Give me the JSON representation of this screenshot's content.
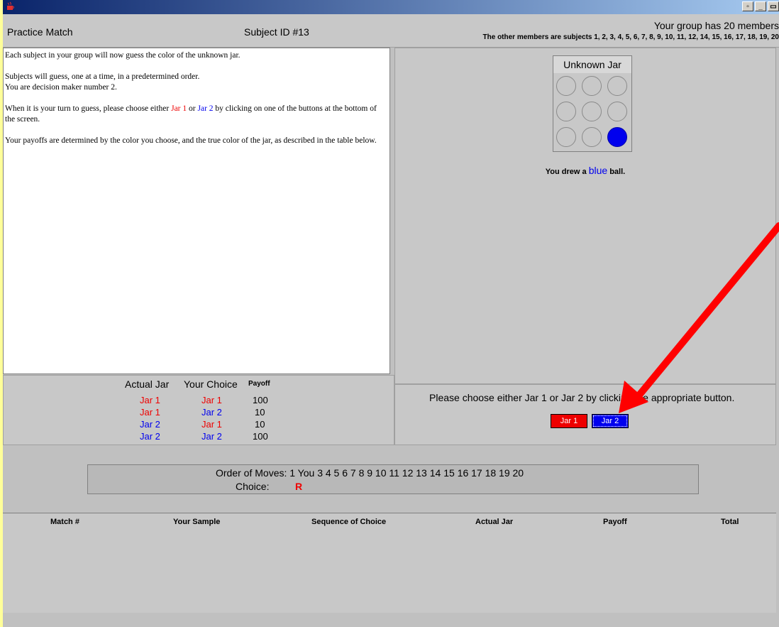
{
  "window": {
    "title_icon": "java-cup-icon",
    "controls": [
      "-□",
      "_",
      "▭"
    ]
  },
  "header": {
    "left": "Practice Match",
    "middle": "Subject ID #13",
    "right_title": "Your group has 20 members",
    "right_sub": "The other members are subjects 1, 2, 3, 4, 5, 6, 7, 8, 9, 10, 11, 12, 14, 15, 16, 17, 18, 19, 20"
  },
  "instructions": {
    "p1": "Each subject in your group will now guess the color of the unknown jar.",
    "p2a": "Subjects will guess, one at a time, in a predetermined order.",
    "p2b": "You are decision maker number 2.",
    "p3_pre": "When it is your turn to guess, please choose either ",
    "p3_jar1": "Jar 1",
    "p3_or": " or ",
    "p3_jar2": "Jar 2",
    "p3_post": " by clicking on one of the buttons at the bottom of the screen.",
    "p4": "Your payoffs are determined by the color you choose, and the true color of the jar, as described in the table below."
  },
  "jar": {
    "title": "Unknown Jar",
    "drew_prefix": "You drew a ",
    "drew_color": "blue",
    "drew_suffix": " ball."
  },
  "choose": {
    "prompt": "Please choose either Jar 1 or Jar 2 by clicking the appropriate button.",
    "jar1_label": "Jar 1",
    "jar2_label": "Jar 2"
  },
  "payoff_table": {
    "headers": [
      "Actual Jar",
      "Your Choice",
      "Payoff"
    ],
    "rows": [
      [
        "Jar 1",
        "Jar 1",
        "100"
      ],
      [
        "Jar 1",
        "Jar 2",
        "10"
      ],
      [
        "Jar 2",
        "Jar 1",
        "10"
      ],
      [
        "Jar 2",
        "Jar 2",
        "100"
      ]
    ]
  },
  "order": {
    "label": "Order of Moves:  1  You  3  4  5  6  7  8  9  10  11  12  13  14  15  16  17  18  19  20",
    "choice_label": "Choice:",
    "choice_value": "R"
  },
  "history": {
    "headers": [
      "Match #",
      "Your Sample",
      "Sequence of Choice",
      "Actual Jar",
      "Payoff",
      "Total"
    ]
  },
  "colors": {
    "red": "#ee0000",
    "blue": "#0000ee",
    "arrow": "#ff0000"
  }
}
